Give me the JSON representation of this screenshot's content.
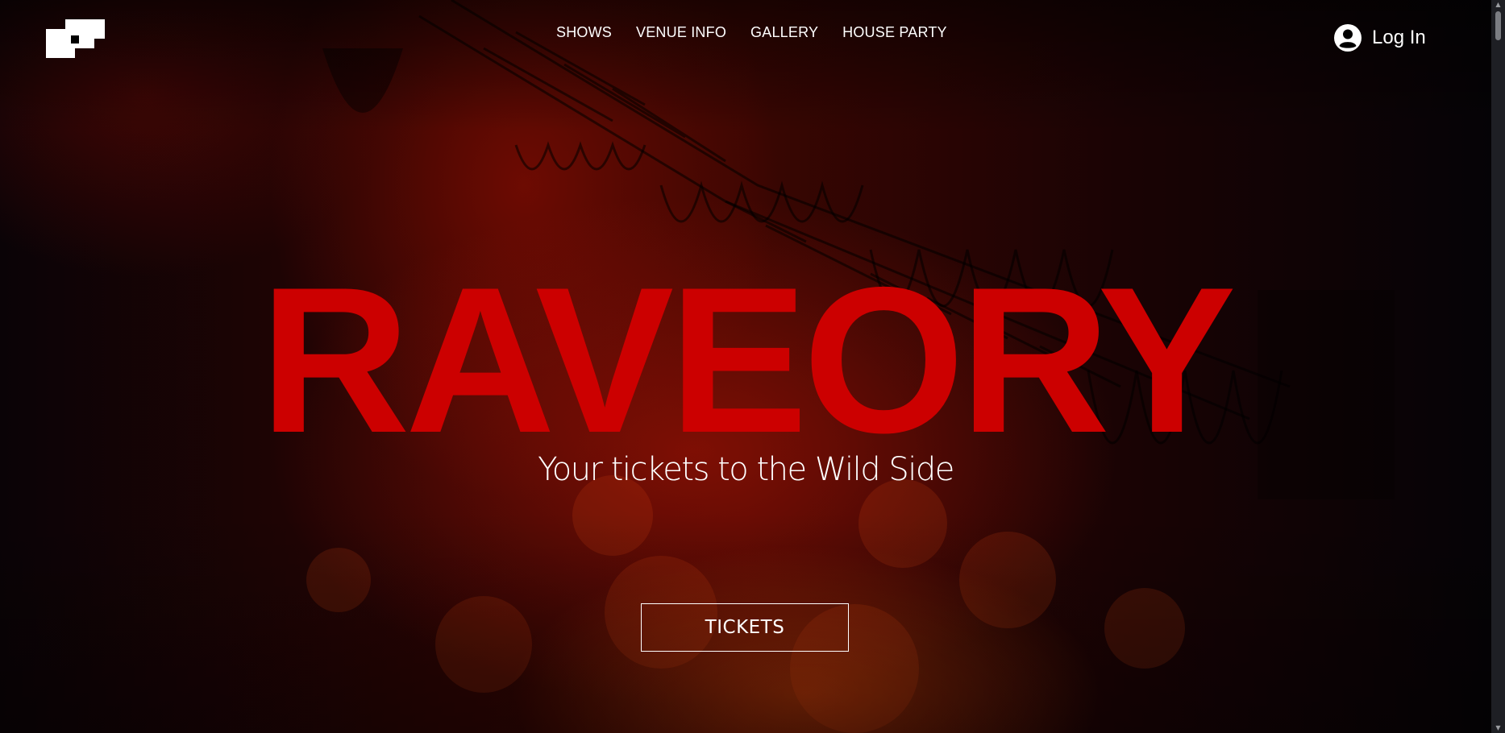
{
  "header": {
    "logo_icon": "raveory-pixel-logo-icon",
    "nav": [
      {
        "label": "SHOWS"
      },
      {
        "label": "VENUE INFO"
      },
      {
        "label": "GALLERY"
      },
      {
        "label": "HOUSE PARTY"
      }
    ],
    "login": {
      "icon": "user-circle-icon",
      "label": "Log In"
    }
  },
  "hero": {
    "brand": "RAVEORY",
    "tagline": "Your tickets to the Wild Side",
    "cta_label": "TICKETS",
    "background": "concert-crowd-photo"
  },
  "colors": {
    "brand_red": "#cc0000",
    "text": "#ffffff",
    "background_dark": "#050307"
  },
  "scrollbar": {
    "up_arrow": "▲",
    "down_arrow": "▼"
  }
}
